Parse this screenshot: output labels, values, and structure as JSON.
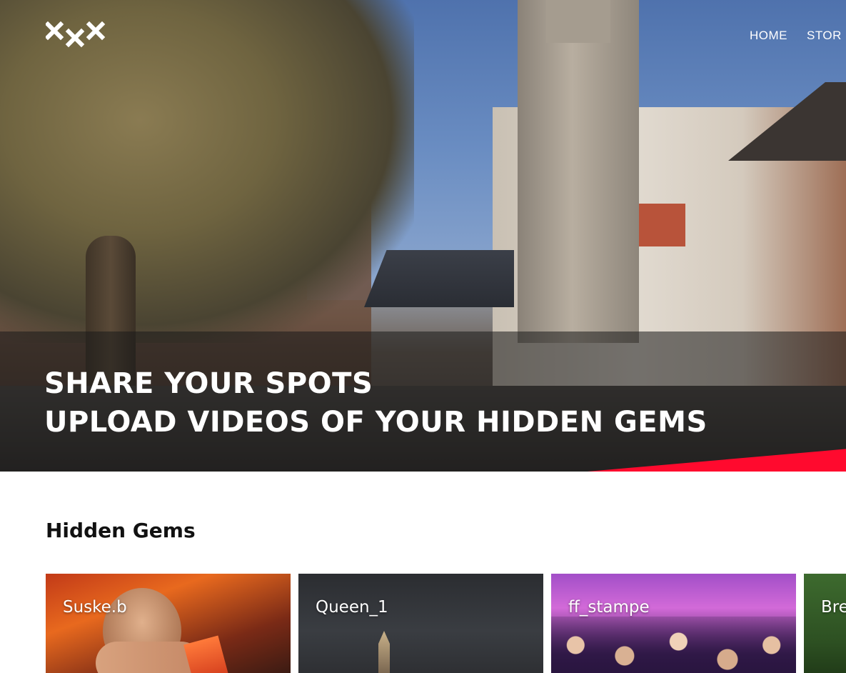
{
  "header": {
    "logo_alt": "XXX",
    "nav": [
      {
        "label": "HOME"
      },
      {
        "label": "STOR"
      }
    ]
  },
  "hero": {
    "line1": "SHARE YOUR SPOTS",
    "line2": "UPLOAD VIDEOS OF YOUR HIDDEN GEMS"
  },
  "section": {
    "title": "Hidden Gems",
    "cards": [
      {
        "label": "Suske.b"
      },
      {
        "label": "Queen_1"
      },
      {
        "label": "ff_stampe"
      },
      {
        "label": "Bre"
      }
    ]
  },
  "colors": {
    "accent": "#ff0a2e",
    "text_dark": "#111111",
    "text_light": "#ffffff"
  }
}
